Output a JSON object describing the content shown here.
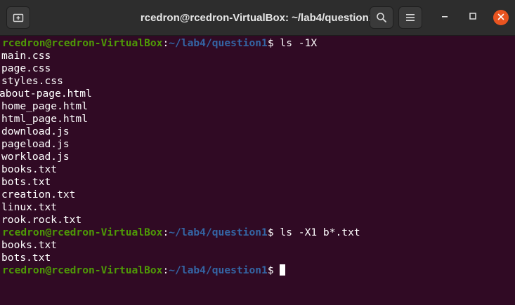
{
  "window": {
    "title": "rcedron@rcedron-VirtualBox: ~/lab4/question1",
    "buttons": {
      "new_tab_icon": "new-tab-icon",
      "search_icon": "search-icon",
      "menu_icon": "hamburger-menu-icon",
      "minimize_icon": "minimize-icon",
      "maximize_icon": "maximize-icon",
      "close_icon": "close-icon"
    },
    "close_color": "#e95420"
  },
  "terminal": {
    "background": "#300a24",
    "prompt": {
      "user_host": "rcedron@rcedron-VirtualBox",
      "colon": ":",
      "path": "~/lab4/question1",
      "symbol": "$"
    },
    "command1": " ls -1X",
    "output1": [
      "main.css",
      "page.css",
      "styles.css",
      "about-page.html",
      "home_page.html",
      "html_page.html",
      "download.js",
      "pageload.js",
      "workload.js",
      "books.txt",
      "bots.txt",
      "creation.txt",
      "linux.txt",
      "rook.rock.txt"
    ],
    "command2": " ls -X1 b*.txt",
    "output2": [
      "books.txt",
      "bots.txt"
    ],
    "command3": " "
  }
}
